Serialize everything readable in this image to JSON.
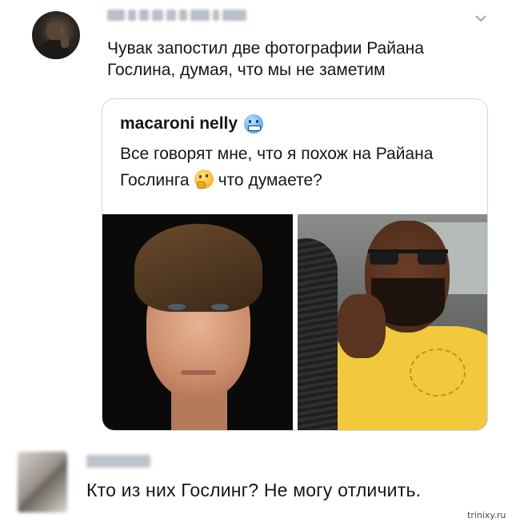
{
  "tweet": {
    "text": "Чувак запостил две фотографии Райана Гослина, думая, что мы не заметим",
    "chevron_icon": "chevron-down-icon"
  },
  "quote": {
    "author": "macaroni nelly",
    "author_emoji": "cold-face-emoji",
    "text_before": "Все говорят мне, что я похож на Райана Гослинга",
    "text_emoji": "thinking-face-emoji",
    "text_after": "что думаете?"
  },
  "reply": {
    "text": "Кто из них Гослинг? Не могу отличить."
  },
  "watermark": "trinixy.ru",
  "colors": {
    "text": "#14171a",
    "border": "#cfd6dc",
    "blur_placeholder": "#b9c0c7"
  }
}
